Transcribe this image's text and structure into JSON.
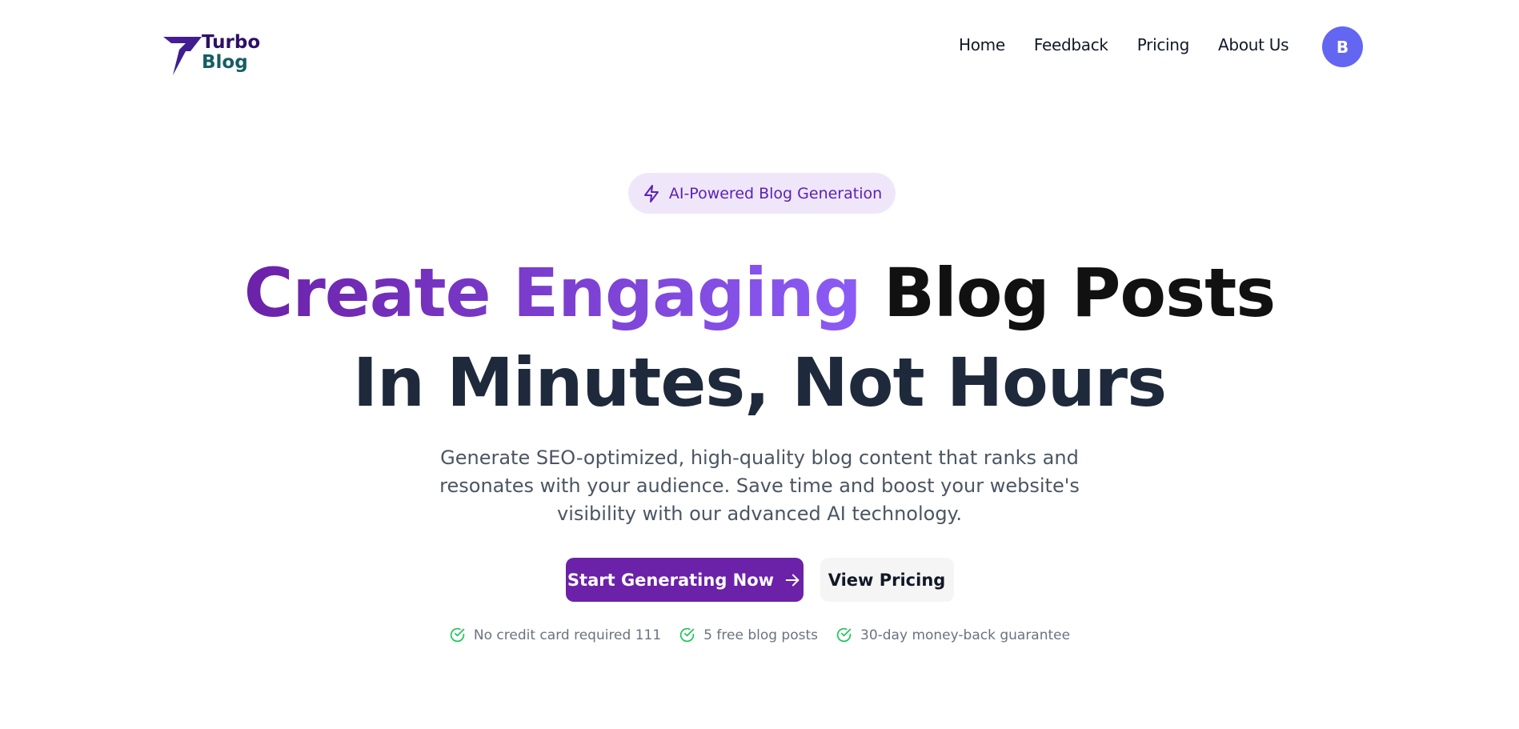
{
  "brand": {
    "line1": "Turbo",
    "line2": "Blog",
    "mark_color": "#4c1d95",
    "accent_teal": "#155e63"
  },
  "nav": {
    "items": [
      {
        "label": "Home"
      },
      {
        "label": "Feedback"
      },
      {
        "label": "Pricing"
      },
      {
        "label": "About Us"
      }
    ]
  },
  "user": {
    "avatar_initial": "B",
    "avatar_color": "#6366f1"
  },
  "hero": {
    "badge": {
      "icon": "lightning-icon",
      "label": "AI-Powered Blog Generation"
    },
    "headline": {
      "gradient_part": "Create Engaging",
      "dark_part": "Blog Posts",
      "line2": "In Minutes, Not Hours"
    },
    "subtitle": "Generate SEO-optimized, high-quality blog content that ranks and resonates with your audience. Save time and boost your website's visibility with our advanced AI technology.",
    "primary_cta": {
      "label": "Start Generating Now",
      "icon": "arrow-right-icon"
    },
    "secondary_cta": {
      "label": "View Pricing"
    },
    "features": [
      {
        "icon": "check-circle-icon",
        "label": "No credit card required 111"
      },
      {
        "icon": "check-circle-icon",
        "label": "5 free blog posts"
      },
      {
        "icon": "check-circle-icon",
        "label": "30-day money-back guarantee"
      }
    ]
  },
  "colors": {
    "primary": "#6b21a8",
    "gradient_end": "#8b5cf6",
    "badge_bg": "#f0e6fa",
    "check_green": "#22c55e"
  }
}
